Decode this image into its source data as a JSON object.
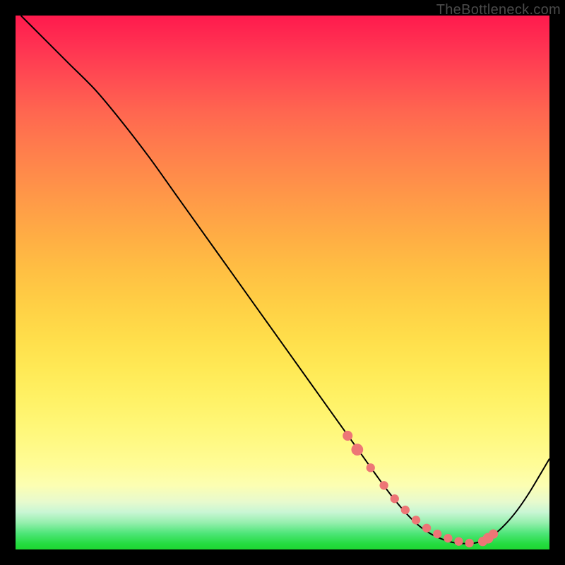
{
  "watermark": "TheBottleneck.com",
  "chart_data": {
    "type": "line",
    "title": "",
    "xlabel": "",
    "ylabel": "",
    "xlim": [
      0,
      100
    ],
    "ylim": [
      0,
      100
    ],
    "series": [
      {
        "name": "curve",
        "x": [
          1,
          3,
          6,
          10,
          15,
          20,
          25,
          30,
          35,
          40,
          45,
          50,
          55,
          60,
          62,
          64,
          66,
          68,
          70,
          72,
          74,
          76,
          78,
          80,
          82,
          84,
          86,
          88,
          90,
          92,
          94,
          96,
          98,
          100
        ],
        "y": [
          100,
          98,
          95,
          91,
          86,
          80,
          73.5,
          66.5,
          59.5,
          52.5,
          45.5,
          38.5,
          31.5,
          24.5,
          21.7,
          18.9,
          16.1,
          13.3,
          10.6,
          8.1,
          5.9,
          4.1,
          2.8,
          1.9,
          1.3,
          1.1,
          1.2,
          1.8,
          3.1,
          5.0,
          7.4,
          10.3,
          13.6,
          17
        ]
      }
    ],
    "dots": {
      "x": [
        62.2,
        64.0,
        66.5,
        69.0,
        71.0,
        73.0,
        75.0,
        77.0,
        79.0,
        81.0,
        83.0,
        85.0,
        87.5,
        88.5,
        89.5
      ],
      "y": [
        21.3,
        18.7,
        15.3,
        12.0,
        9.5,
        7.4,
        5.5,
        4.0,
        2.9,
        2.1,
        1.5,
        1.2,
        1.5,
        2.1,
        2.9
      ],
      "r": [
        3.2,
        3.8,
        2.8,
        2.8,
        2.8,
        2.8,
        2.8,
        2.8,
        2.8,
        2.8,
        2.8,
        2.8,
        3.0,
        3.4,
        3.0
      ]
    },
    "gradient_stops": [
      {
        "pos": 0,
        "color": "#ff1a4d"
      },
      {
        "pos": 50,
        "color": "#ffcf45"
      },
      {
        "pos": 85,
        "color": "#fffc96"
      },
      {
        "pos": 100,
        "color": "#1fd633"
      }
    ]
  }
}
